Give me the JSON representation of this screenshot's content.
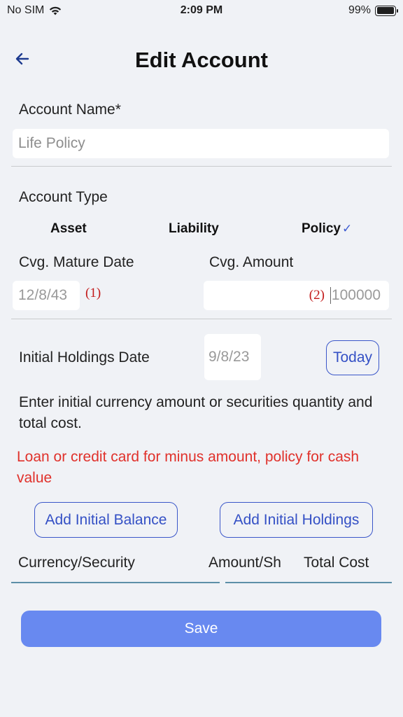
{
  "status_bar": {
    "carrier": "No SIM",
    "time": "2:09 PM",
    "battery": "99%",
    "battery_level": 0.99
  },
  "header": {
    "title": "Edit Account",
    "back_icon": "arrow-left-icon"
  },
  "form": {
    "account_name_label": "Account Name*",
    "account_name_value": "Life Policy",
    "account_type_label": "Account Type",
    "account_types": [
      "Asset",
      "Liability",
      "Policy"
    ],
    "selected_account_type": "Policy",
    "check_mark": "✓",
    "mature_date_label": "Cvg. Mature Date",
    "mature_date_value": "12/8/43",
    "mature_date_annotation": "(1)",
    "coverage_amount_label": "Cvg. Amount",
    "coverage_amount_annotation": "(2)",
    "coverage_amount_value": "100000",
    "initial_holdings_date_label": "Initial Holdings Date",
    "initial_holdings_date_value": "9/8/23",
    "today_button": "Today",
    "info_text": "Enter initial currency amount or securities quantity and total cost.",
    "warning_text": "Loan or credit card for minus amount, policy for cash value",
    "add_initial_balance_button": "Add Initial Balance",
    "add_initial_holdings_button": "Add Initial Holdings"
  },
  "holdings_table": {
    "columns": [
      "Currency/Security",
      "Amount/Sh",
      "Total Cost"
    ]
  },
  "save_button": "Save",
  "colors": {
    "accent": "#3450c5",
    "save_button": "#6889f0",
    "warning": "#e0312b",
    "annotation": "#c21818",
    "background": "#f0f2f6"
  }
}
